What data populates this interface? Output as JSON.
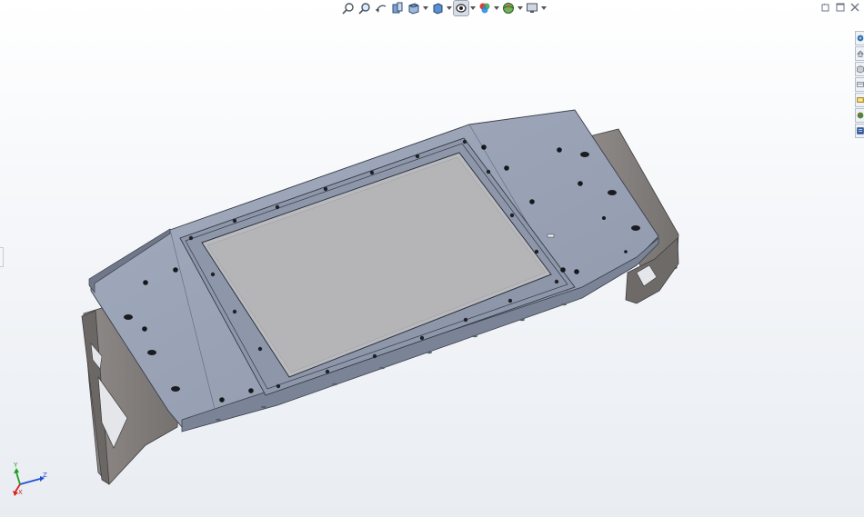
{
  "colors": {
    "plate": "#98a1b4",
    "plate_dark": "#7d8698",
    "window_glass": "#b5b5b7",
    "bracket": "#8b8785",
    "triad_x": "#d42121",
    "triad_y": "#1f9e1f",
    "triad_z": "#1f4fd8"
  },
  "heads_up_toolbar": {
    "buttons": [
      {
        "icon": "zoom-to-fit-icon"
      },
      {
        "icon": "zoom-to-area-icon"
      },
      {
        "icon": "previous-view-icon"
      },
      {
        "icon": "section-view-icon"
      },
      {
        "icon": "view-orientation-icon"
      },
      {
        "icon": "display-style-icon"
      },
      {
        "icon": "hide-show-items-icon"
      },
      {
        "icon": "edit-appearance-icon"
      },
      {
        "icon": "apply-scene-icon"
      },
      {
        "icon": "view-settings-icon"
      }
    ]
  },
  "window_controls": [
    {
      "icon": "restore-icon"
    },
    {
      "icon": "maximize-icon"
    },
    {
      "icon": "close-icon"
    }
  ],
  "task_pane": {
    "tabs": [
      {
        "icon": "solidworks-resources-icon"
      },
      {
        "icon": "design-library-icon"
      },
      {
        "icon": "file-explorer-icon"
      },
      {
        "icon": "view-palette-icon"
      },
      {
        "icon": "appearances-icon"
      },
      {
        "icon": "custom-properties-icon"
      },
      {
        "icon": "forum-icon"
      }
    ]
  },
  "triad": {
    "x_label": "X",
    "y_label": "Y",
    "z_label": "Z"
  }
}
